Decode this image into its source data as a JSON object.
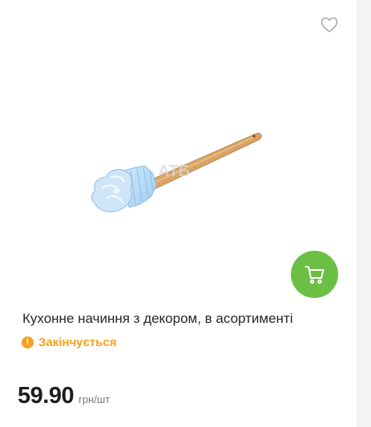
{
  "product": {
    "title": "Кухонне начиння з декором, в асортименті",
    "status": "Закінчується",
    "price": "59.90",
    "unit": "грн/шт",
    "watermark": "АТБ"
  },
  "icons": {
    "favorite": "heart-outline-icon",
    "cart": "shopping-cart-icon",
    "status": "exclamation-icon"
  },
  "colors": {
    "accent_green": "#6bbf45",
    "warning_orange": "#f5a020",
    "text_dark": "#1e1e1e",
    "text_muted": "#7a7a7a",
    "heart_grey": "#a6a6a6"
  }
}
